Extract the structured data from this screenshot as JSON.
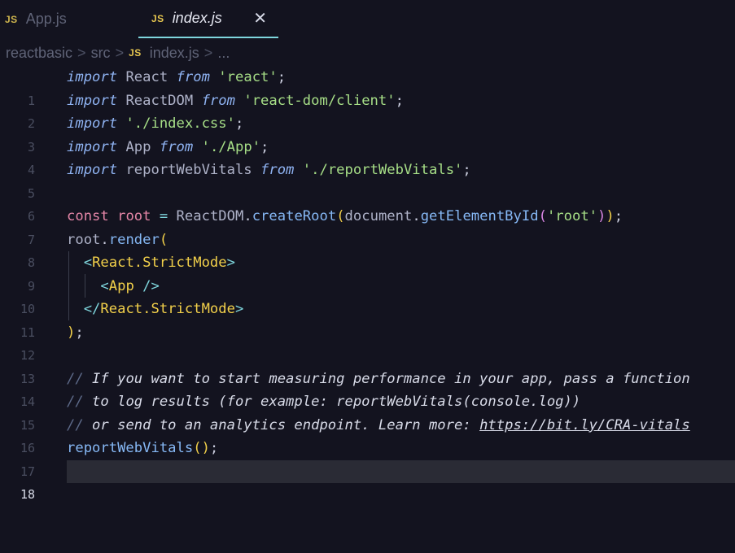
{
  "tabs": [
    {
      "badge": "JS",
      "label": "App.js",
      "active": false
    },
    {
      "badge": "JS",
      "label": "index.js",
      "active": true,
      "close": "✕"
    }
  ],
  "breadcrumb": {
    "parts": [
      "reactbasic",
      "src"
    ],
    "separator": ">",
    "file_badge": "JS",
    "file": "index.js",
    "ellipsis": "..."
  },
  "editor": {
    "current_line": 18,
    "lines": [
      {
        "n": "1"
      },
      {
        "n": "2"
      },
      {
        "n": "3"
      },
      {
        "n": "4"
      },
      {
        "n": "5"
      },
      {
        "n": "6"
      },
      {
        "n": "7"
      },
      {
        "n": "8"
      },
      {
        "n": "9"
      },
      {
        "n": "10"
      },
      {
        "n": "11"
      },
      {
        "n": "12"
      },
      {
        "n": "13"
      },
      {
        "n": "14"
      },
      {
        "n": "15"
      },
      {
        "n": "16"
      },
      {
        "n": "17"
      },
      {
        "n": "18"
      }
    ],
    "code": {
      "l1": {
        "kw": "import",
        "id": " React ",
        "from": "from",
        "str": "'react'",
        "end": ";"
      },
      "l2": {
        "kw": "import",
        "id": " ReactDOM ",
        "from": "from",
        "str": "'react-dom/client'",
        "end": ";"
      },
      "l3": {
        "kw": "import",
        "str": " './index.css'",
        "end": ";"
      },
      "l4": {
        "kw": "import",
        "id": " App ",
        "from": "from",
        "str": "'./App'",
        "end": ";"
      },
      "l5": {
        "kw": "import",
        "id": " reportWebVitals ",
        "from": "from",
        "str": "'./reportWebVitals'",
        "end": ";"
      },
      "l7": {
        "const": "const",
        "var": " root ",
        "eq": "=",
        "obj": " ReactDOM",
        "dot": ".",
        "fn": "createRoot",
        "p1": "(",
        "doc": "document",
        "dot2": ".",
        "fn2": "getElementById",
        "p2": "(",
        "str": "'root'",
        "p2c": ")",
        "p1c": ")",
        "end": ";"
      },
      "l8": {
        "obj": "root",
        "dot": ".",
        "fn": "render",
        "p": "("
      },
      "l9": {
        "open": "<",
        "tag": "React.StrictMode",
        "close": ">"
      },
      "l10": {
        "open": "<",
        "tag": "App",
        "close": " />"
      },
      "l11": {
        "open": "</",
        "tag": "React.StrictMode",
        "close": ">"
      },
      "l12": {
        "p": ")",
        "end": ";"
      },
      "l14": {
        "slash": "//",
        "text": " If you want to start measuring performance in your app, pass a function"
      },
      "l15": {
        "slash": "//",
        "text": " to log results (for example: reportWebVitals(console.log))"
      },
      "l16": {
        "slash": "//",
        "text": " or send to an analytics endpoint. Learn more: ",
        "link": "https://bit.ly/CRA-vitals"
      },
      "l17": {
        "fn": "reportWebVitals",
        "p": "()",
        "end": ";"
      }
    }
  }
}
